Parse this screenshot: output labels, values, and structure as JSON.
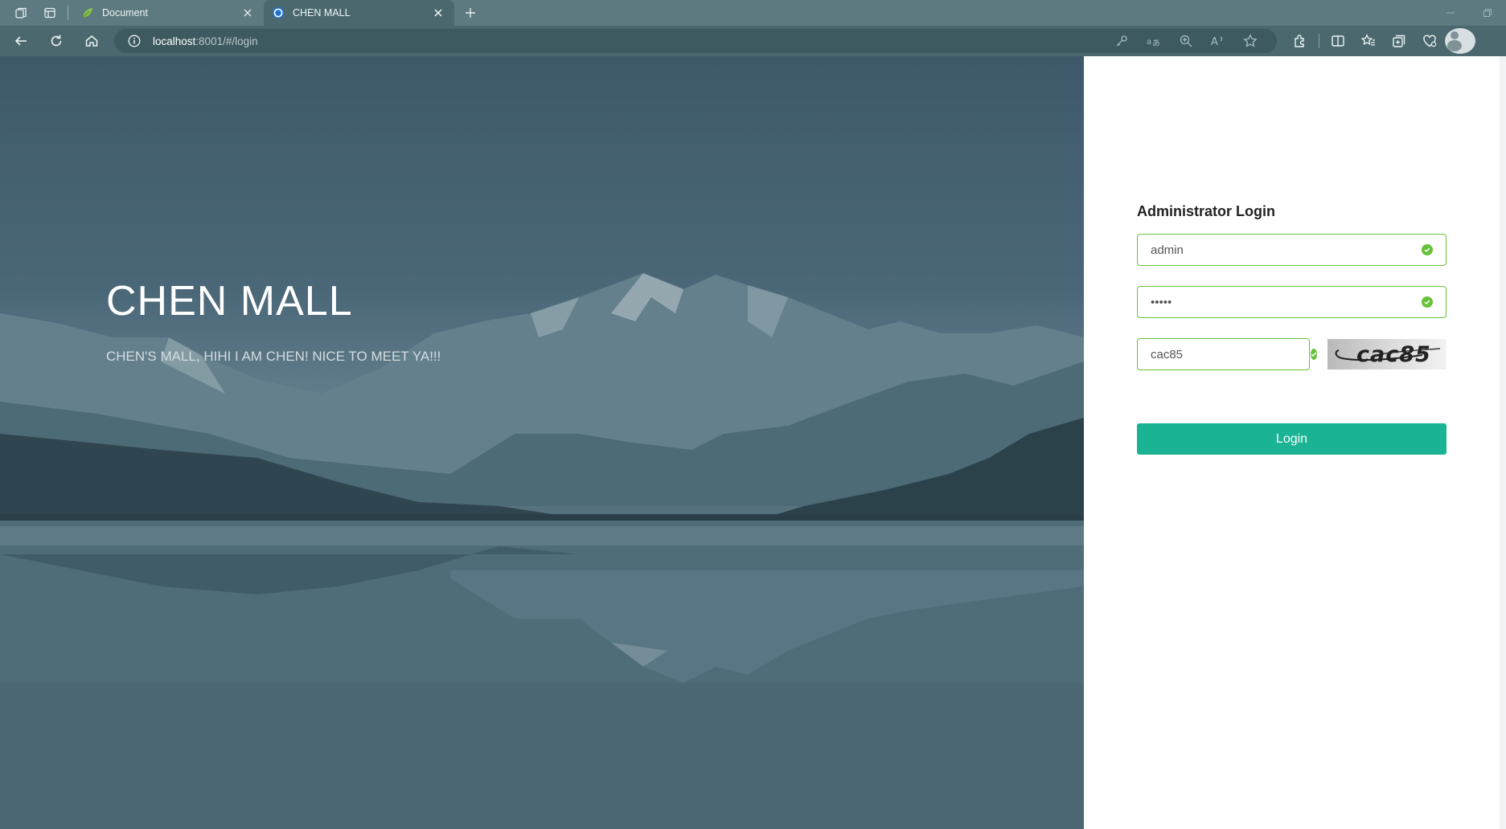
{
  "browser": {
    "tabs": [
      {
        "title": "Document",
        "icon": "leaf-icon",
        "active": false
      },
      {
        "title": "CHEN MALL",
        "icon": "app-logo-icon",
        "active": true
      }
    ],
    "address": {
      "host": "localhost",
      "rest": ":8001/#/login"
    }
  },
  "hero": {
    "title": "CHEN MALL",
    "subtitle": "CHEN'S MALL, HIHI I AM CHEN! NICE TO MEET YA!!!"
  },
  "login": {
    "heading": "Administrator Login",
    "username": "admin",
    "password": "•••••",
    "captcha_input": "cac85",
    "captcha_image_text": "cac85",
    "submit_label": "Login"
  },
  "colors": {
    "success": "#67c23a",
    "primary_button": "#1ab394",
    "browser_chrome": "#4a686e"
  }
}
